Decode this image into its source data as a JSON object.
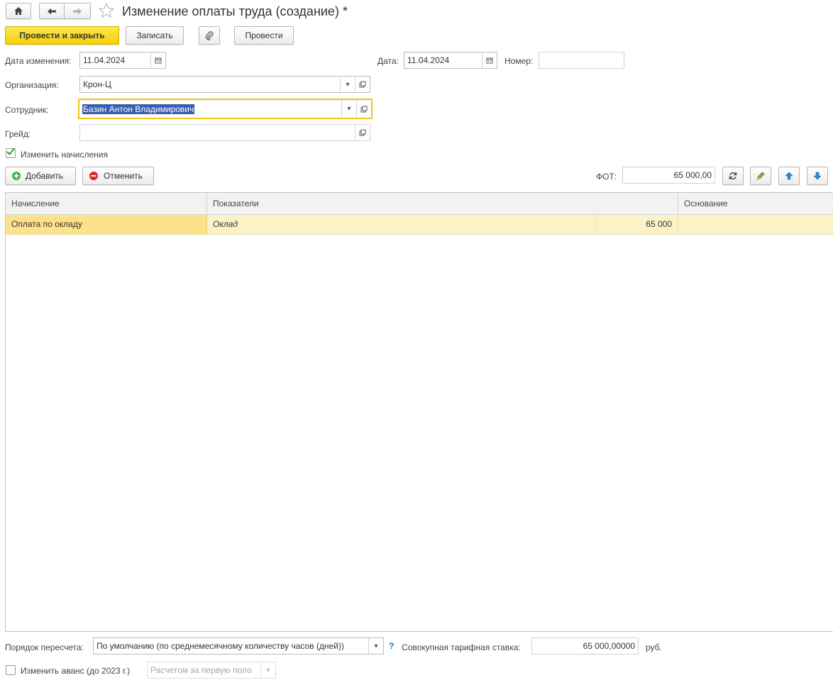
{
  "window": {
    "title": "Изменение оплаты труда (создание) *"
  },
  "toolbar": {
    "post_close_label": "Провести и закрыть",
    "save_label": "Записать",
    "post_label": "Провести"
  },
  "header": {
    "change_date_label": "Дата изменения:",
    "change_date_value": "11.04.2024",
    "date_label": "Дата:",
    "date_value": "11.04.2024",
    "number_label": "Номер:",
    "number_value": "",
    "organization_label": "Организация:",
    "organization_value": "Крон-Ц",
    "employee_label": "Сотрудник:",
    "employee_value": "Базин Антон Владимирович",
    "grade_label": "Грейд:",
    "grade_value": ""
  },
  "accruals": {
    "change_checkbox_label": "Изменить начисления",
    "change_checked": true,
    "add_label": "Добавить",
    "cancel_label": "Отменить",
    "fot_label": "ФОТ:",
    "fot_value": "65 000,00"
  },
  "table": {
    "columns": [
      "Начисление",
      "Показатели",
      "Основание"
    ],
    "rows": [
      {
        "accrual": "Оплата по окладу",
        "indicator": "Оклад",
        "indicator_value": "65 000",
        "basis": ""
      }
    ]
  },
  "footer": {
    "recalc_label": "Порядок пересчета:",
    "recalc_value": "По умолчанию (по среднемесячному количеству часов (дней))",
    "help_mark": "?",
    "rate_label": "Совокупная тарифная ставка:",
    "rate_value": "65 000,00000",
    "rate_unit": "руб.",
    "advance_label": "Изменить аванс (до 2023 г.)",
    "advance_checked": false,
    "advance_value": "Расчетом за первую поло"
  },
  "colors": {
    "primary_button": "#f5cf0a",
    "selected_row": "#fbf3c7",
    "focus_border": "#f0c514",
    "text_selection": "#3a5cb0"
  }
}
